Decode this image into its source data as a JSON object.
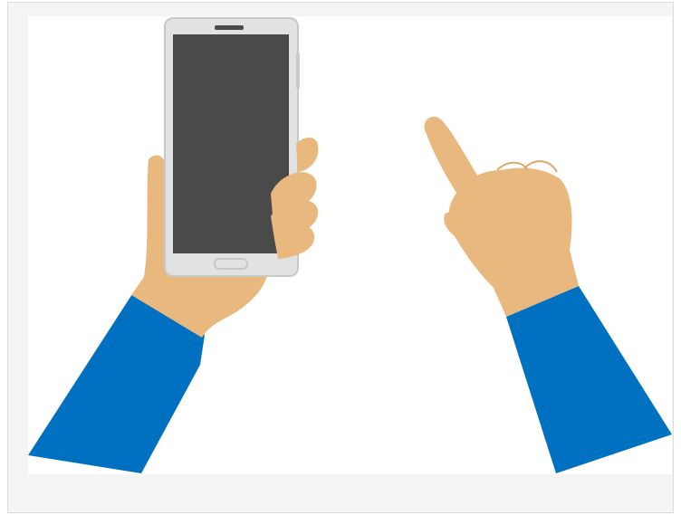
{
  "illustration": {
    "subject": "hand-holding-phone-and-pointing-hand",
    "colors": {
      "background": "#ffffff",
      "frame": "#f4f4f4",
      "frame_border": "#dcdcdc",
      "sleeve": "#0070c0",
      "skin": "#e8b87e",
      "skin_shadow": "#dfa86a",
      "phone_body": "#e2e2e2",
      "phone_edge": "#c8c8c8",
      "phone_screen": "#4a4a4a"
    }
  }
}
